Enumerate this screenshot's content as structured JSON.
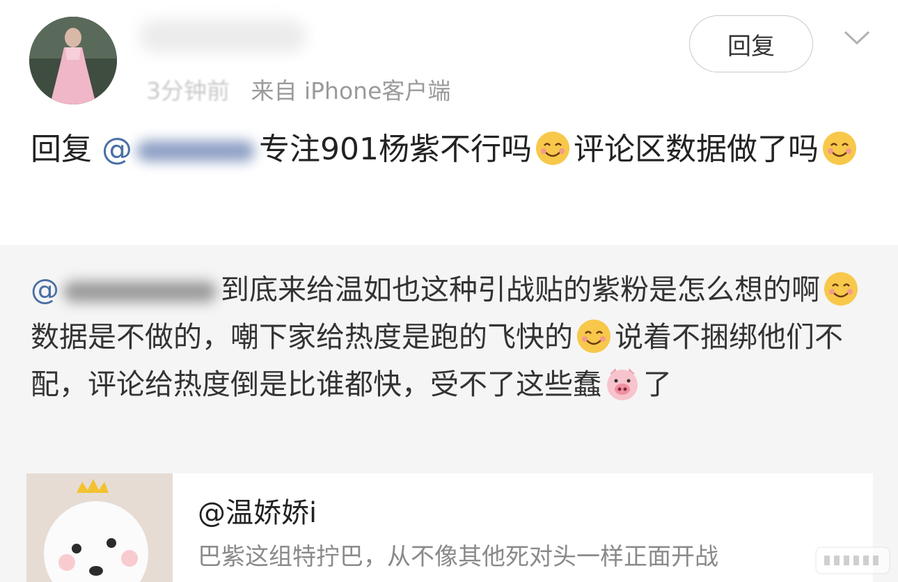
{
  "post_header": {
    "source": "来自 iPhone客户端",
    "time_blurred": "3分钟前",
    "reply_button": "回复"
  },
  "comment": {
    "prefix": "回复",
    "mention_start": "@",
    "text_part1": "专注901杨紫不行吗",
    "text_part2": "评论区数据做了吗"
  },
  "quote": {
    "mention_start": "@",
    "part1": "到底来给温如也这种引战贴的紫粉是怎么想的啊",
    "part2": "数据是不做的，嘲下家给热度是跑的飞快的",
    "part3": "说着不捆绑他们不配，评论给热度倒是比谁都快，受不了这些蠢",
    "part4": "了"
  },
  "card": {
    "title": "@温娇娇i",
    "desc": "巴紫这组特拧巴，从不像其他死对头一样正面开战"
  },
  "icons": {
    "emoji_smile": "smiling-face-emoji",
    "emoji_pig": "pig-face-emoji",
    "chevron": "chevron-down-icon"
  }
}
